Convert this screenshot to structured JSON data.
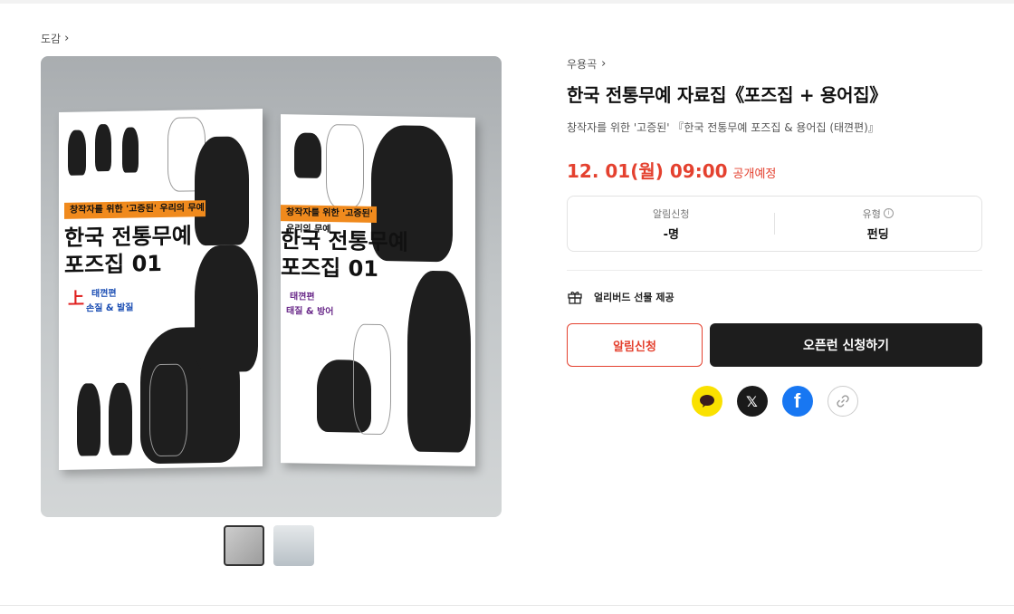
{
  "breadcrumb": {
    "label": "도감"
  },
  "gallery": {
    "book1": {
      "banner": "창작자를 위한 '고증된' 우리의 무예",
      "title_line1": "한국 전통무예",
      "title_line2": "포즈집 01",
      "mark": "上",
      "sub1": "태껸편",
      "sub2": "손질 & 발질"
    },
    "book2": {
      "banner": "창작자를 위한 '고증된' 우리의 무예",
      "title_line1": "한국 전통무예",
      "title_line2": "포즈집 01",
      "sub1": "태껸편",
      "sub2": "태질 & 방어"
    }
  },
  "product": {
    "category": "우용곡",
    "title": "한국 전통무예 자료집《포즈집 + 용어집》",
    "subtitle": "창작자를 위한 '고증된' 『한국 전통무예 포즈집 & 용어집 (태껸편)』",
    "date": "12. 01(월) 09:00",
    "date_status": "공개예정",
    "info": {
      "alarm_label": "알림신청",
      "alarm_value": "-명",
      "type_label": "유형",
      "type_value": "펀딩"
    },
    "gift": "얼리버드 선물 제공",
    "buttons": {
      "alert": "알림신청",
      "open": "오픈런 신청하기"
    }
  },
  "share": {
    "icons": [
      "kakaotalk-icon",
      "x-icon",
      "facebook-icon",
      "link-icon"
    ]
  },
  "colors": {
    "accent": "#e4412f",
    "dark_button": "#1d1d1d",
    "kakao": "#fae100",
    "facebook": "#1877f2"
  }
}
